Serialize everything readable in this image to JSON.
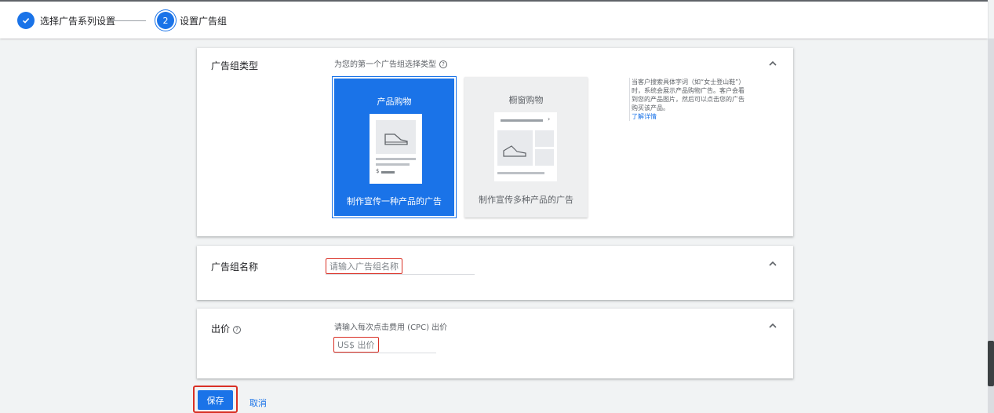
{
  "stepper": {
    "step1": {
      "label": "选择广告系列设置",
      "icon": "check-icon",
      "status": "completed"
    },
    "step2": {
      "number": "2",
      "label": "设置广告组",
      "status": "current"
    }
  },
  "ad_group_type": {
    "title": "广告组类型",
    "hint": "为您的第一个广告组选择类型",
    "options": [
      {
        "name": "产品购物",
        "description": "制作宣传一种产品的广告",
        "selected": true,
        "price_glyph": "$"
      },
      {
        "name": "橱窗购物",
        "description": "制作宣传多种产品的广告",
        "selected": false
      }
    ],
    "side_text": "当客户搜索具体字词（如“女士登山鞋”）时，系统会展示产品购物广告。客户会看到您的产品图片，然后可以点击您的广告购买该产品。",
    "learn_more": "了解详情"
  },
  "ad_group_name": {
    "title": "广告组名称",
    "placeholder": "请输入广告组名称"
  },
  "bid": {
    "title": "出价",
    "hint": "请输入每次点击费用 (CPC) 出价",
    "placeholder": "US$ 出价"
  },
  "actions": {
    "save": "保存",
    "cancel": "取消"
  },
  "icons": {
    "collapse": "chevron-up-icon",
    "help": "help-circle-icon"
  },
  "colors": {
    "accent": "#1a73e8",
    "highlight": "#d93025",
    "background": "#f1f3f4"
  }
}
